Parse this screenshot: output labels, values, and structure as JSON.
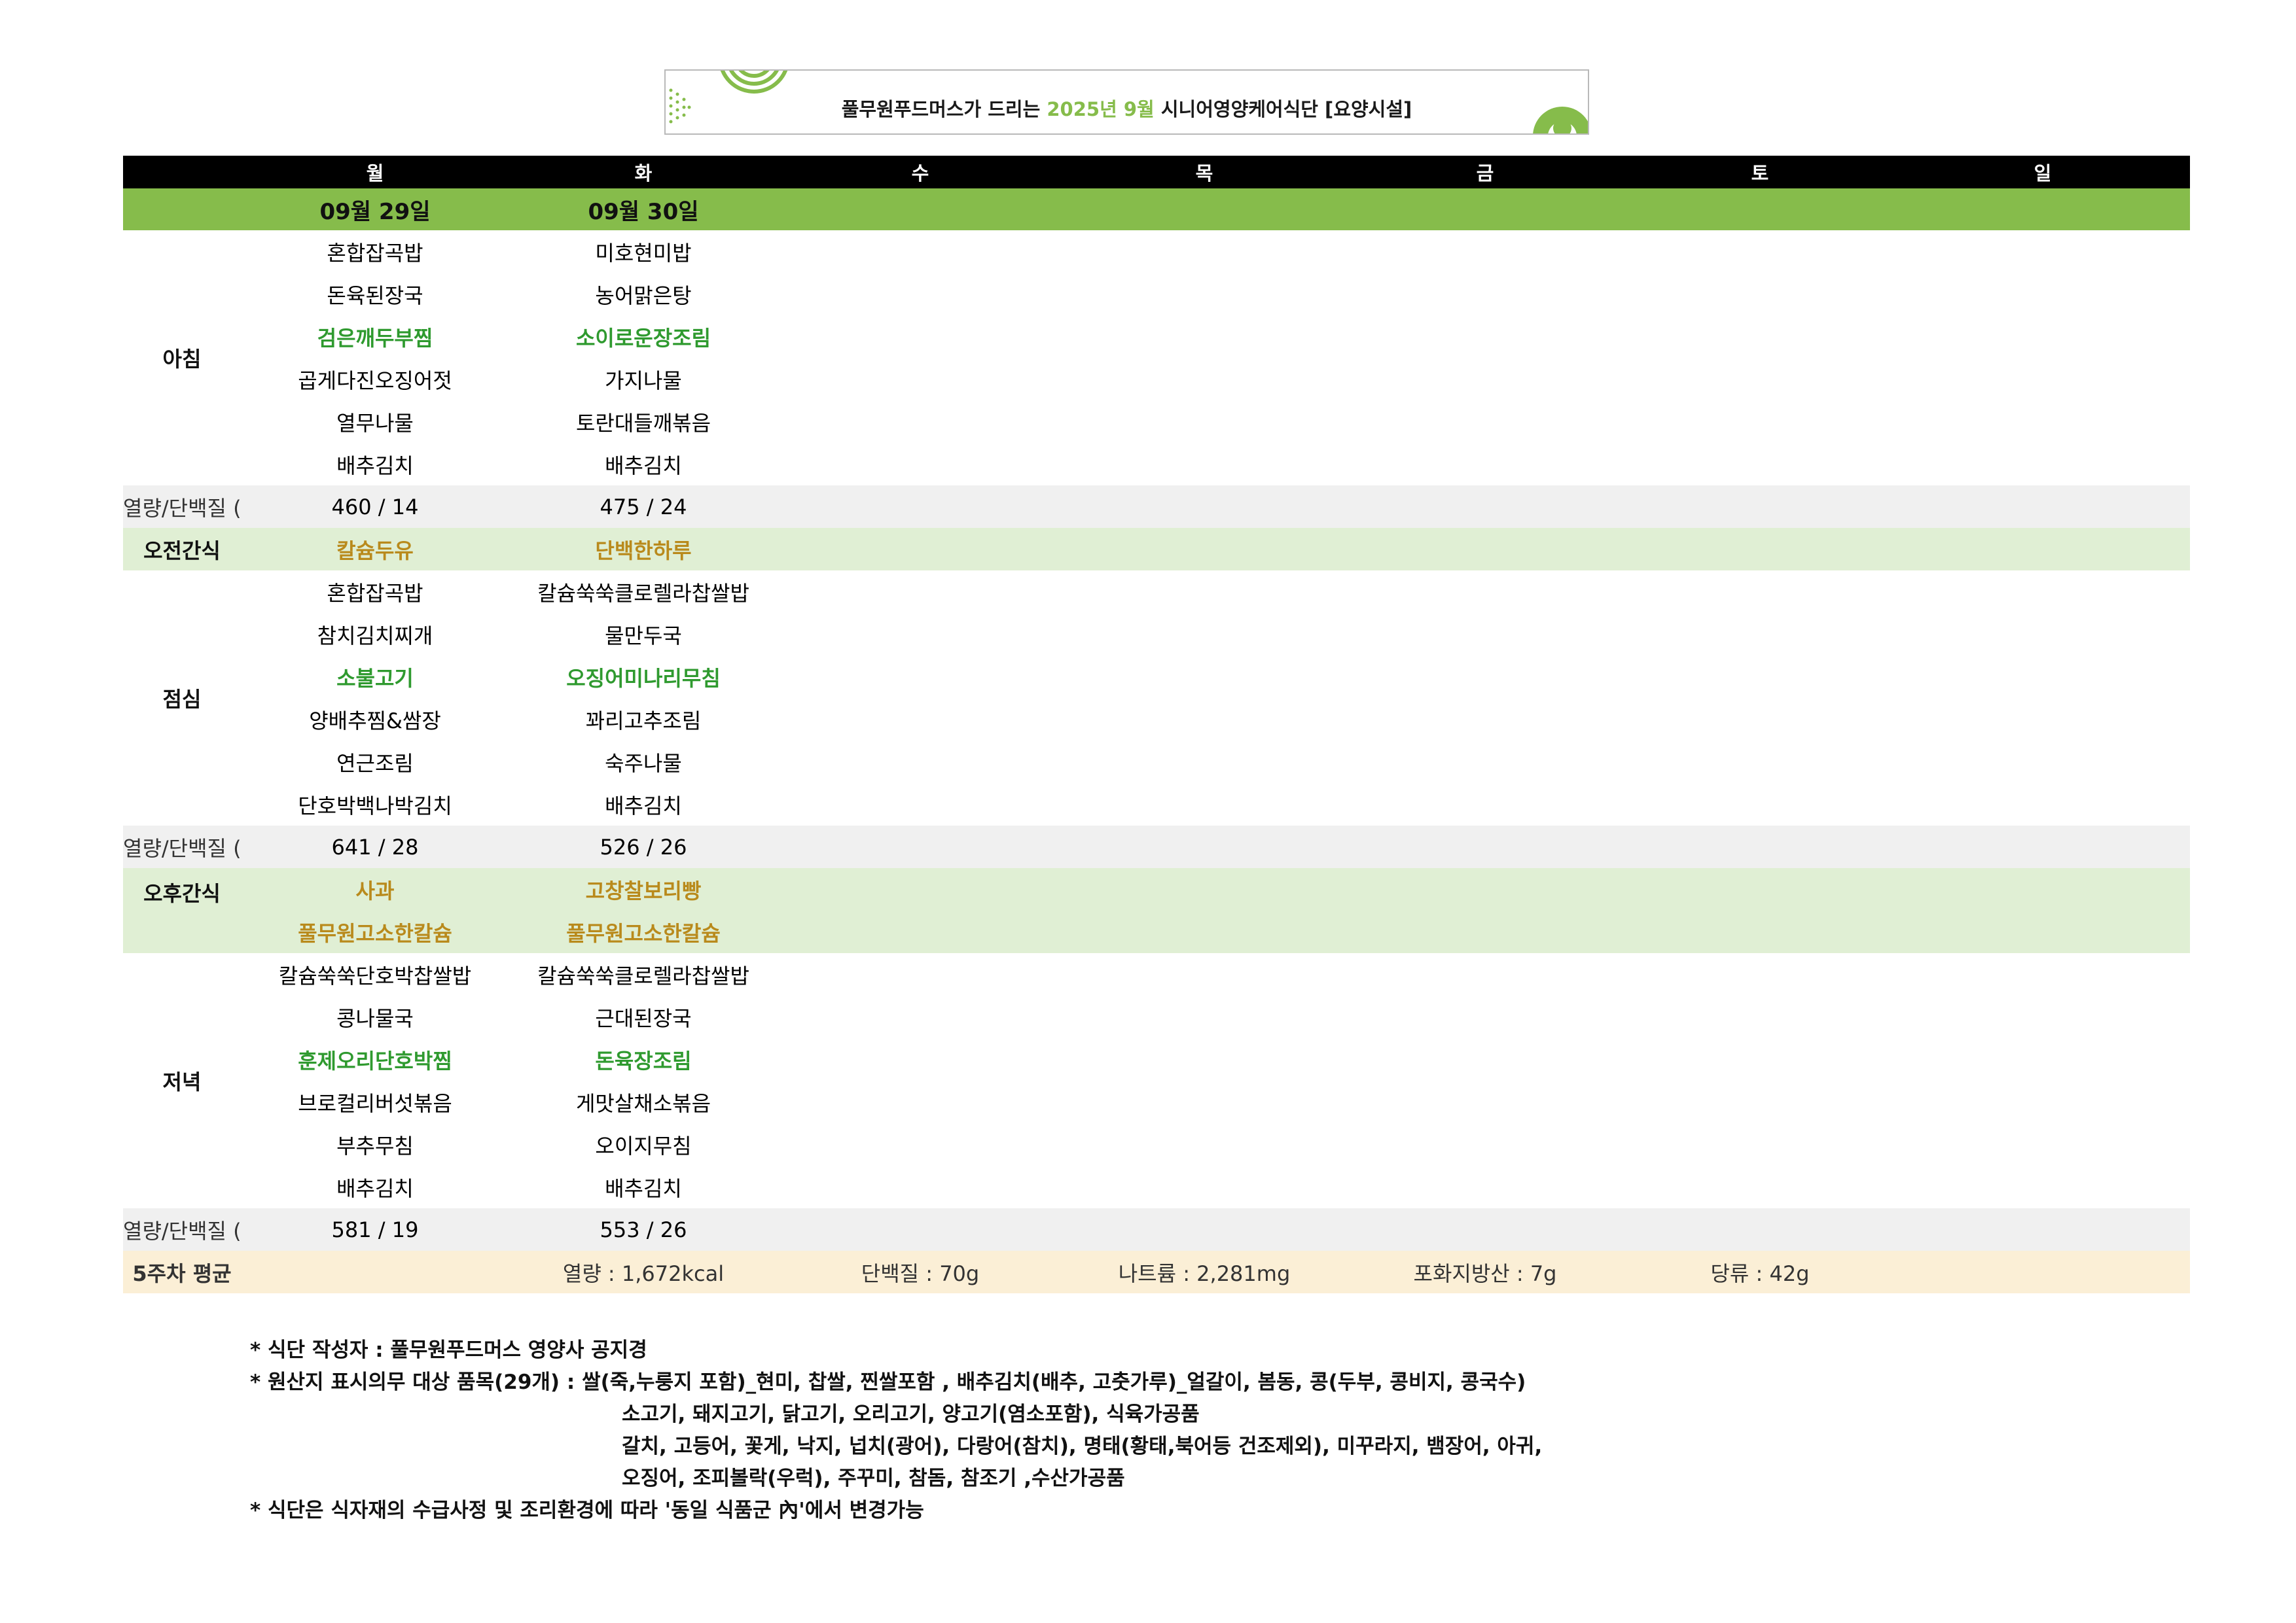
{
  "header": {
    "title_pre": "풀무원푸드머스가 드리는",
    "title_highlight": "2025년 9월",
    "title_post": "시니어영양케어식단 [요양시설]",
    "accent_color": "#86bc4b"
  },
  "days": [
    "월",
    "화",
    "수",
    "목",
    "금",
    "토",
    "일"
  ],
  "dates": [
    "09월 29일",
    "09월 30일"
  ],
  "meals": {
    "breakfast": {
      "label": "아침",
      "mon": [
        "혼합잡곡밥",
        "돈육된장국",
        "검은깨두부찜",
        "곱게다진오징어젓",
        "열무나물",
        "배추김치"
      ],
      "tue": [
        "미호현미밥",
        "농어맑은탕",
        "소이로운장조림",
        "가지나물",
        "토란대들깨볶음",
        "배추김치"
      ]
    },
    "am_snack": {
      "label": "오전간식",
      "mon": "칼슘두유",
      "tue": "단백한하루"
    },
    "lunch": {
      "label": "점심",
      "mon": [
        "혼합잡곡밥",
        "참치김치찌개",
        "소불고기",
        "양배추찜&쌈장",
        "연근조림",
        "단호박백나박김치"
      ],
      "tue": [
        "칼슘쑥쑥클로렐라찹쌀밥",
        "물만두국",
        "오징어미나리무침",
        "꽈리고추조림",
        "숙주나물",
        "배추김치"
      ]
    },
    "pm_snack": {
      "label": "오후간식",
      "mon": [
        "사과",
        "풀무원고소한칼슘"
      ],
      "tue": [
        "고창찰보리빵",
        "풀무원고소한칼슘"
      ]
    },
    "dinner": {
      "label": "저녁",
      "mon": [
        "칼슘쑥쑥단호박찹쌀밥",
        "콩나물국",
        "훈제오리단호박찜",
        "브로컬리버섯볶음",
        "부추무침",
        "배추김치"
      ],
      "tue": [
        "칼슘쑥쑥클로렐라찹쌀밥",
        "근대된장국",
        "돈육장조림",
        "게맛살채소볶음",
        "오이지무침",
        "배추김치"
      ]
    }
  },
  "kcal_label": "열량/단백질 (kcal/g)",
  "kcal": {
    "breakfast": [
      "460 / 14",
      "475 / 24"
    ],
    "lunch": [
      "641 / 28",
      "526 / 26"
    ],
    "dinner": [
      "581 / 19",
      "553 / 26"
    ]
  },
  "summary": {
    "label": "5주차 평균",
    "calories": "열량 : 1,672kcal",
    "protein": "단백질 : 70g",
    "sodium": "나트륨 : 2,281mg",
    "sat_fat": "포화지방산 : 7g",
    "sugar": "당류 : 42g"
  },
  "notes": [
    "* 식단 작성자 : 풀무원푸드머스 영양사 공지경",
    "* 원산지 표시의무 대상 품목(29개) : 쌀(죽,누룽지 포함)_현미, 찹쌀, 찐쌀포함 , 배추김치(배추, 고춧가루)_얼갈이, 봄동, 콩(두부, 콩비지, 콩국수)",
    "소고기, 돼지고기, 닭고기, 오리고기, 양고기(염소포함), 식육가공품",
    "갈치, 고등어, 꽃게, 낙지, 넙치(광어), 다랑어(참치), 명태(황태,북어등 건조제외), 미꾸라지, 뱀장어, 아귀,",
    "오징어, 조피볼락(우럭), 주꾸미, 참돔, 참조기 ,수산가공품",
    "* 식단은 식자재의 수급사정 및 조리환경에 따라 '동일 식품군 內'에서 변경가능"
  ]
}
